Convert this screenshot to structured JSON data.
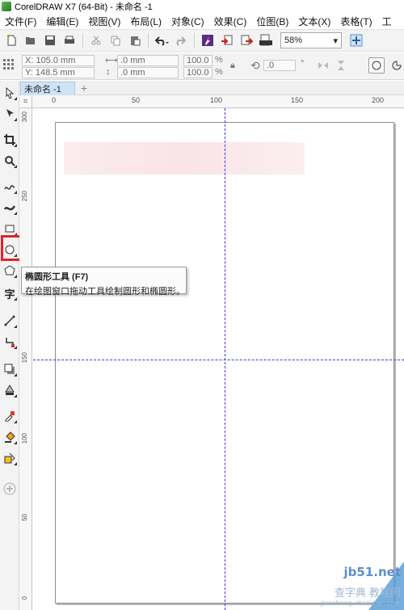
{
  "window": {
    "title": "CorelDRAW X7 (64-Bit) - 未命名 -1"
  },
  "menu": [
    "文件(F)",
    "编辑(E)",
    "视图(V)",
    "布局(L)",
    "对象(C)",
    "效果(C)",
    "位图(B)",
    "文本(X)",
    "表格(T)",
    "工"
  ],
  "toolbar": {
    "zoom_value": "58%"
  },
  "properties": {
    "x": "X: 105.0 mm",
    "y": "Y: 148.5 mm",
    "w": ".0 mm",
    "h": ".0 mm",
    "scale_x": "100.0",
    "scale_y": "100.0",
    "pct": "%",
    "angle": ".0",
    "degree": "°"
  },
  "document": {
    "tab": "未命名 -1",
    "add": "+"
  },
  "ruler": {
    "top": [
      "0",
      "50",
      "100",
      "150",
      "200"
    ],
    "left": [
      "300",
      "250",
      "200",
      "150",
      "100",
      "50",
      "0"
    ]
  },
  "tooltip": {
    "title": "椭圆形工具 (F7)",
    "description": "在绘图窗口拖动工具绘制圆形和椭圆形。"
  },
  "watermark": {
    "line1": "jb51.net",
    "line2": "查字典 教程网",
    "line3": "jiaocheng.chazidian.com"
  },
  "colors": {
    "highlight": "#e8202a",
    "guide": "#3a3ad8",
    "tab_active": "#cfe3f7"
  },
  "icons": [
    "new-document-icon",
    "open-icon",
    "save-icon",
    "print-icon",
    "cut-icon",
    "copy-icon",
    "paste-icon",
    "undo-icon",
    "redo-icon",
    "corel-launcher-icon",
    "import-icon",
    "export-icon",
    "pdf-export-icon",
    "full-screen-icon"
  ]
}
